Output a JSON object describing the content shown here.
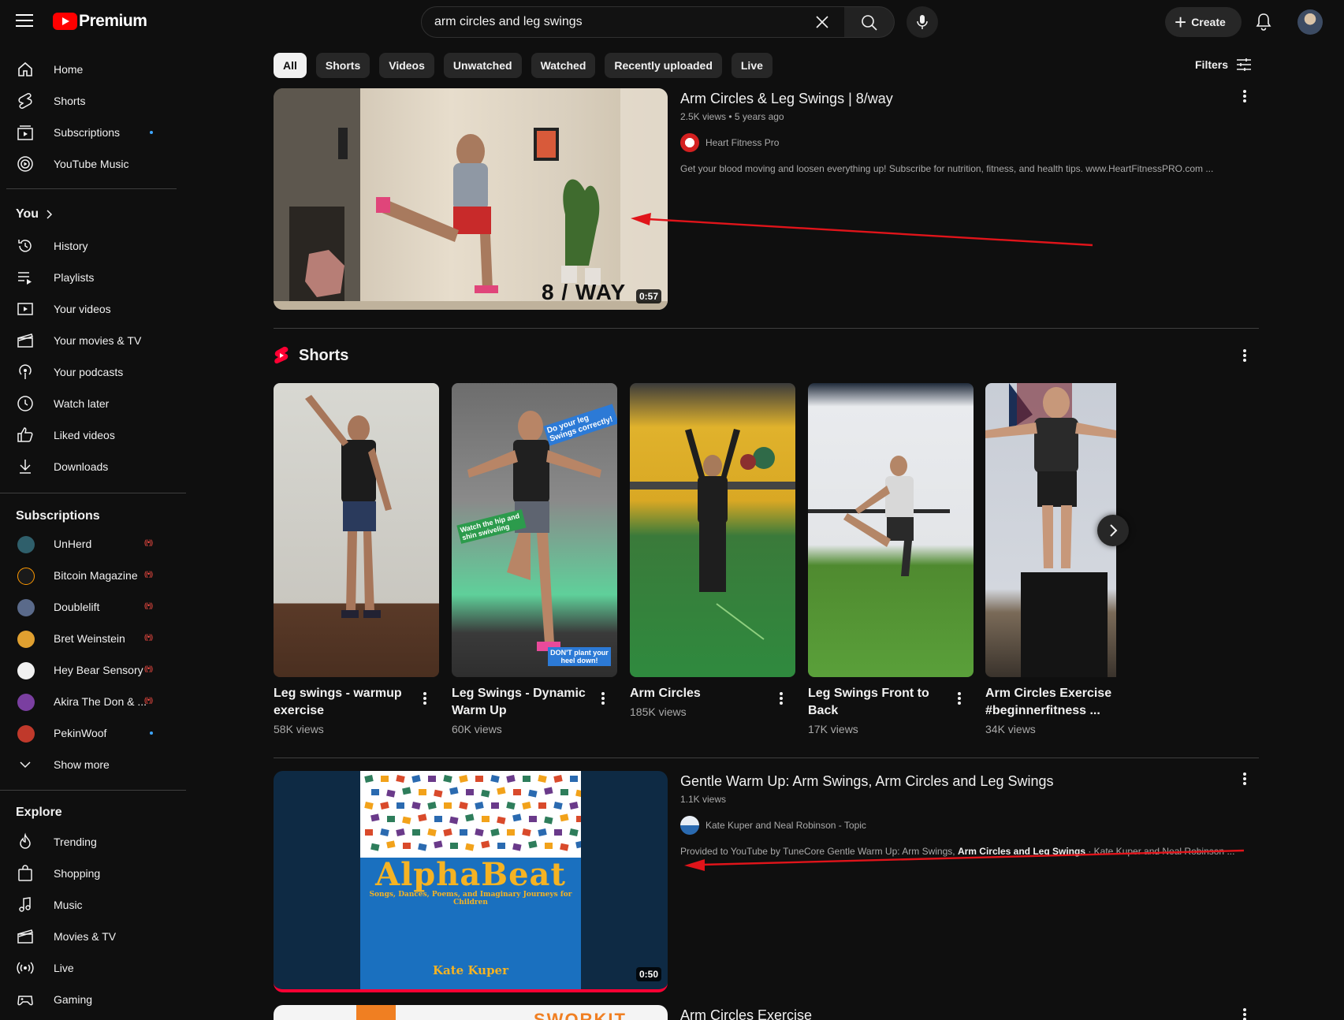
{
  "header": {
    "logo_text": "Premium",
    "search_value": "arm circles and leg swings",
    "create_label": "Create"
  },
  "sidebar": {
    "main": [
      {
        "label": "Home",
        "icon": "home-icon"
      },
      {
        "label": "Shorts",
        "icon": "shorts-icon"
      },
      {
        "label": "Subscriptions",
        "icon": "subscriptions-icon",
        "new_dot": true
      },
      {
        "label": "YouTube Music",
        "icon": "youtube-music-icon"
      }
    ],
    "you_heading": "You",
    "you": [
      {
        "label": "History",
        "icon": "history-icon"
      },
      {
        "label": "Playlists",
        "icon": "playlists-icon"
      },
      {
        "label": "Your videos",
        "icon": "your-videos-icon"
      },
      {
        "label": "Your movies & TV",
        "icon": "movies-icon"
      },
      {
        "label": "Your podcasts",
        "icon": "podcasts-icon"
      },
      {
        "label": "Watch later",
        "icon": "clock-icon"
      },
      {
        "label": "Liked videos",
        "icon": "thumbs-up-icon"
      },
      {
        "label": "Downloads",
        "icon": "download-icon"
      }
    ],
    "subscriptions_heading": "Subscriptions",
    "subscriptions": [
      {
        "label": "UnHerd",
        "status": "live",
        "color": "#2f5f6b"
      },
      {
        "label": "Bitcoin Magazine",
        "status": "live",
        "color": "#1a1a1a"
      },
      {
        "label": "Doublelift",
        "status": "live",
        "color": "#5a6a8a"
      },
      {
        "label": "Bret Weinstein",
        "status": "live",
        "color": "#e0a030"
      },
      {
        "label": "Hey Bear Sensory",
        "status": "live",
        "color": "#f1f1f1"
      },
      {
        "label": "Akira The Don & ...",
        "status": "live",
        "color": "#7a3fa0"
      },
      {
        "label": "PekinWoof",
        "status": "new",
        "color": "#c0392b"
      }
    ],
    "show_more": "Show more",
    "explore_heading": "Explore",
    "explore": [
      {
        "label": "Trending",
        "icon": "trending-icon"
      },
      {
        "label": "Shopping",
        "icon": "shopping-bag-icon"
      },
      {
        "label": "Music",
        "icon": "music-note-icon"
      },
      {
        "label": "Movies & TV",
        "icon": "movies-icon"
      },
      {
        "label": "Live",
        "icon": "live-icon"
      },
      {
        "label": "Gaming",
        "icon": "gaming-icon"
      }
    ]
  },
  "chips": [
    "All",
    "Shorts",
    "Videos",
    "Unwatched",
    "Watched",
    "Recently uploaded",
    "Live"
  ],
  "filters_label": "Filters",
  "results": [
    {
      "title": "Arm Circles & Leg Swings | 8/way",
      "meta": "2.5K views • 5 years ago",
      "channel": "Heart Fitness Pro",
      "description": "Get your blood moving and loosen everything up! Subscribe for nutrition, fitness, and health tips. www.HeartFitnessPRO.com ...",
      "duration": "0:57",
      "overlay_text": "8 / WAY"
    },
    {
      "title": "Gentle Warm Up: Arm Swings, Arm Circles and Leg Swings",
      "meta": "1.1K views",
      "channel": "Kate Kuper and Neal Robinson - Topic",
      "description_prefix": "Provided to YouTube by TuneCore Gentle Warm Up: Arm Swings, ",
      "description_bold": "Arm Circles and Leg Swings",
      "description_suffix": " · Kate Kuper and Neal Robinson ...",
      "duration": "0:50",
      "album_title": "AlphaBeat",
      "album_subtitle": "Songs, Dances, Poems, and Imaginary Journeys for Children",
      "album_artist": "Kate Kuper"
    },
    {
      "title": "Arm Circles Exercise",
      "thumb_text": "SWORKIT"
    }
  ],
  "shorts_shelf": {
    "title": "Shorts",
    "items": [
      {
        "title": "Leg swings - warmup exercise",
        "views": "58K views"
      },
      {
        "title": "Leg Swings - Dynamic Warm Up",
        "views": "60K views",
        "sticker_top": "Do your leg Swings correctly!",
        "sticker_mid": "Watch the hip and shin swiveling",
        "sticker_bottom": "DON'T plant your heel down!"
      },
      {
        "title": "Arm Circles",
        "views": "185K views"
      },
      {
        "title": "Leg Swings Front to Back",
        "views": "17K views"
      },
      {
        "title": "Arm Circles Exercise #beginnerfitness ...",
        "views": "34K views"
      }
    ]
  },
  "colors": {
    "background": "#0f0f0f",
    "brand_red": "#ff0000",
    "accent_blue": "#3ea6ff",
    "annotation_red": "#e0141a"
  }
}
